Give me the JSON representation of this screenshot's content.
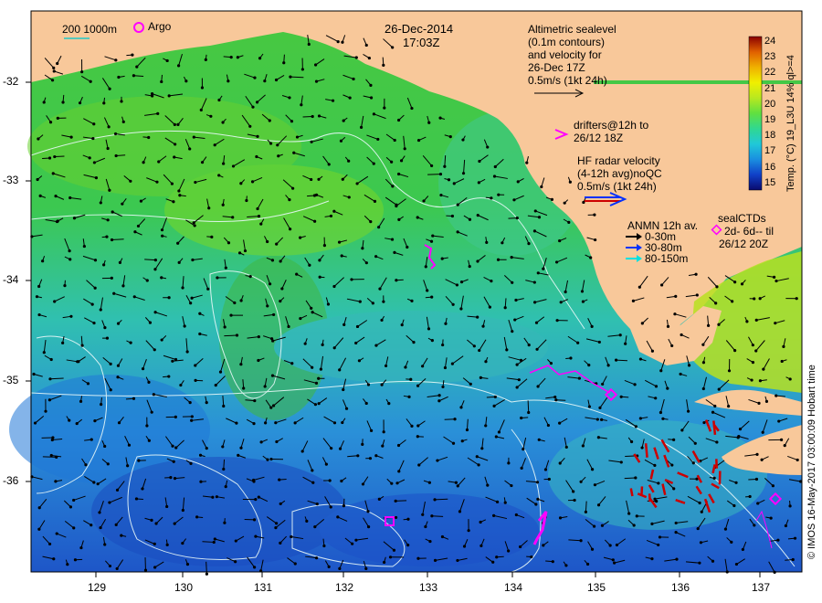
{
  "header": {
    "date": "26-Dec-2014",
    "time": "17:03Z"
  },
  "scale_legend": {
    "isobaths": "200  1000m",
    "argo": "Argo"
  },
  "altimetry": {
    "line1": "Altimetric sealevel",
    "line2": "(0.1m contours)",
    "line3": "and velocity for",
    "line4": "26-Dec 17Z",
    "line5": "0.5m/s (1kt 24h)"
  },
  "drifters": {
    "marker": ">",
    "line1": "drifters@12h to",
    "line2": "26/12 18Z"
  },
  "hf_radar": {
    "line1": "HF radar velocity",
    "line2": "(4-12h avg)noQC",
    "line3": "0.5m/s (1kt 24h)"
  },
  "anmn": {
    "title": "ANMN 12h av.",
    "items": [
      {
        "label": "0-30m",
        "color": "#000000"
      },
      {
        "label": "30-80m",
        "color": "#0033ff"
      },
      {
        "label": "80-150m",
        "color": "#00e0e0"
      }
    ]
  },
  "seal_ctds": {
    "title": "sealCTDs",
    "line2": "2d- 6d-- til",
    "line3": "26/12 20Z"
  },
  "axes": {
    "x_ticks": [
      "129",
      "130",
      "131",
      "132",
      "133",
      "134",
      "135",
      "136",
      "137"
    ],
    "y_ticks": [
      "-32",
      "-33",
      "-34",
      "-35",
      "-36"
    ]
  },
  "colorbar": {
    "ticks": [
      "24",
      "23",
      "22",
      "21",
      "20",
      "19",
      "18",
      "17",
      "16",
      "15"
    ],
    "label": "Temp. (°C) 19_L3U 14% ql>=4",
    "colors": [
      "#0a0a6e",
      "#1040c8",
      "#1a8fe0",
      "#20c8d8",
      "#30d890",
      "#60e040",
      "#b8e820",
      "#f0f000",
      "#f0b000",
      "#e06000",
      "#b00000",
      "#700000"
    ]
  },
  "credit": "© IMOS 16-May-2017 03:00:09 Hobart time",
  "colors": {
    "land": "#f8c89a",
    "ocean_warm": "#3cc83c",
    "ocean_mid": "#30c0c0",
    "ocean_cold": "#2060d0",
    "contour": "#e8f8f8",
    "drifter": "#ff00ff",
    "hf_radar_arrow": "#cc0000"
  }
}
